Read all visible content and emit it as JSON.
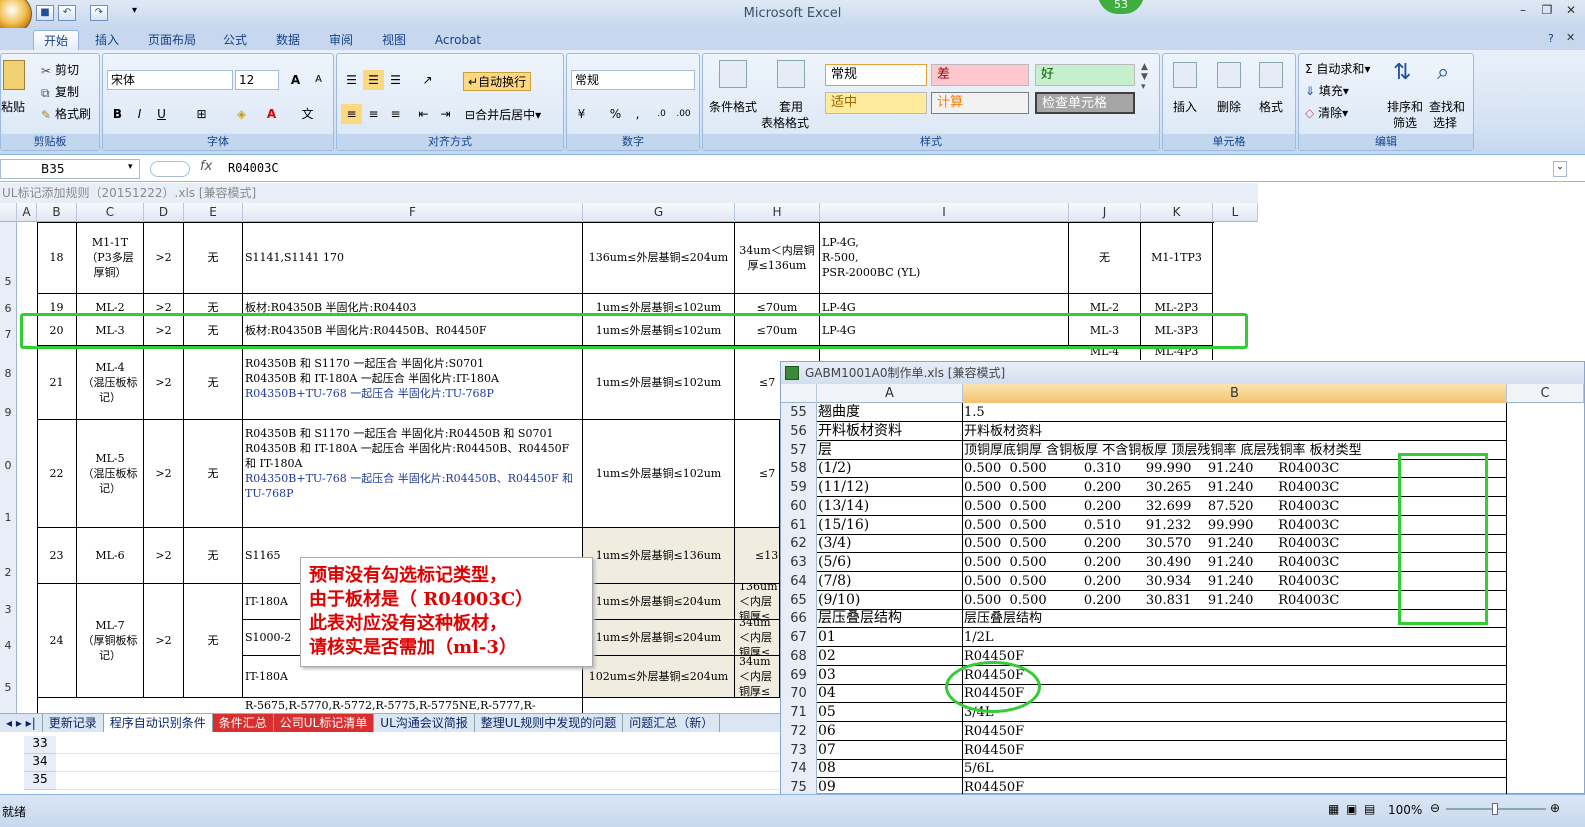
{
  "app": {
    "title": "Microsoft Excel",
    "badge": "53",
    "quick_access": [
      "save",
      "undo",
      "redo"
    ]
  },
  "tabs": [
    "开始",
    "插入",
    "页面布局",
    "公式",
    "数据",
    "审阅",
    "视图",
    "Acrobat"
  ],
  "ribbon": {
    "clipboard": {
      "label": "剪贴板",
      "paste": "粘贴",
      "cut": "剪切",
      "copy": "复制",
      "format_painter": "格式刷"
    },
    "font": {
      "label": "字体",
      "name": "宋体",
      "size": "12",
      "bold": "B",
      "italic": "I",
      "underline": "U",
      "grow": "A",
      "shrink": "A",
      "wen": "文"
    },
    "alignment": {
      "label": "对齐方式",
      "wrap": "自动换行",
      "merge": "合并后居中"
    },
    "number": {
      "label": "数字",
      "format": "常规",
      "percent": "%",
      "comma": ","
    },
    "styles": {
      "label": "样式",
      "cond_format": "条件格式",
      "table_format_1": "套用",
      "table_format_2": "表格格式",
      "normal": "常规",
      "bad": "差",
      "good": "好",
      "neutral": "适中",
      "calc": "计算",
      "check": "检查单元格"
    },
    "cells": {
      "label": "单元格",
      "insert": "插入",
      "delete": "删除",
      "format": "格式"
    },
    "editing": {
      "label": "编辑",
      "autosum": "自动求和",
      "fill": "填充",
      "clear": "清除",
      "sort_1": "排序和",
      "sort_2": "筛选",
      "find_1": "查找和",
      "find_2": "选择"
    }
  },
  "formula_bar": {
    "name_box": "B35",
    "fx": "fx",
    "content": "R04003C"
  },
  "window1": {
    "title": "UL标记添加规则（20151222）.xls  [兼容模式]",
    "columns": [
      "A",
      "B",
      "C",
      "D",
      "E",
      "F",
      "G",
      "H",
      "I",
      "J",
      "K",
      "L"
    ],
    "row_labels": [
      "5",
      "6",
      "7",
      "8",
      "9",
      "0",
      "1",
      "2",
      "3",
      "4",
      "5"
    ],
    "rows": [
      {
        "b": "18",
        "c": "M1-1T\n（P3多层\n厚铜）",
        "d": ">2",
        "e": "无",
        "f": "S1141,S1141 170",
        "g": "136um≤外层基铜≤204um",
        "h": "34um＜内层铜厚≤136um",
        "i": "LP-4G,\nR-500,\nPSR-2000BC (YL)",
        "j": "无",
        "k": "M1-1TP3"
      },
      {
        "b": "19",
        "c": "ML-2",
        "d": ">2",
        "e": "无",
        "f": "板材:R04350B  半固化片:R04403",
        "g": "1um≤外层基铜≤102um",
        "h": "≤70um",
        "i": "LP-4G",
        "j": "ML-2",
        "k": "ML-2P3"
      },
      {
        "b": "20",
        "c": "ML-3",
        "d": ">2",
        "e": "无",
        "f": "板材:R04350B   半固化片:R04450B、R04450F",
        "g": "1um≤外层基铜≤102um",
        "h": "≤70um",
        "i": "LP-4G",
        "j": "ML-3",
        "k": "ML-3P3"
      },
      {
        "b": "21",
        "c": "ML-4\n（混压板标\n记）",
        "d": ">2",
        "e": "无",
        "f1": "R04350B 和 S1170 一起压合 半固化片:S0701",
        "f2": "R04350B 和 IT-180A 一起压合 半固化片:IT-180A",
        "f3": "R04350B+TU-768  一起压合 半固化片:TU-768P",
        "g": "1um≤外层基铜≤102um",
        "h": "≤7",
        "j": "ML-4",
        "k": "ML-4P3"
      },
      {
        "b": "22",
        "c": "ML-5\n（混压板标\n记）",
        "d": ">2",
        "e": "无",
        "f1": "R04350B 和 S1170 一起压合 半固化片:R04450B 和 S0701",
        "f2": "R04350B 和 IT-180A 一起压合 半固化片:R04450B、R04450F 和 IT-180A",
        "f3": "R04350B+TU-768  一起压合 半固化片:R04450B、R04450F 和 TU-768P",
        "g": "1um≤外层基铜≤102um",
        "h": "≤7"
      },
      {
        "b": "23",
        "c": "ML-6",
        "d": ">2",
        "e": "无",
        "f": "S1165",
        "g": "1um≤外层基铜≤136um",
        "h": "≤13"
      },
      {
        "b": "24",
        "c": "ML-7\n（厚铜板标\n记）",
        "d": ">2",
        "e": "无",
        "f1": "IT-180A",
        "f2": "S1000-2",
        "f3": "IT-180A",
        "g1": "1um≤外层基铜≤204um",
        "g2": "1um≤外层基铜≤204um",
        "g3": "102um≤外层基铜≤204um",
        "h1": "136um＜内层铜厚≤",
        "h2": "34um＜内层铜厚≤",
        "h3": "34um＜内层铜厚≤"
      },
      {
        "f": "R-5675,R-5770,R-5772,R-5775,R-5775NE,R-5777,R-"
      }
    ]
  },
  "note": {
    "line1": "预审没有勾选标记类型，",
    "line2": "由于板材是（ R04003C）",
    "line3": "此表对应没有这种板材，",
    "line4": "请核实是否需加（ml-3）"
  },
  "sheet_tabs": [
    "更新记录",
    "程序自动识别条件",
    "条件汇总",
    "公司UL标记清单",
    "UL沟通会议简报",
    "整理UL规则中发现的问题",
    "问题汇总（新）"
  ],
  "sheet_tab_active": "程序自动识别条件",
  "lower_rows": [
    "33",
    "34",
    "35"
  ],
  "window2": {
    "title": "GABM1001A0制作单.xls  [兼容模式]",
    "columns": [
      "A",
      "B",
      "C"
    ],
    "rows": [
      {
        "n": "55",
        "a": "翘曲度",
        "b": "1.5"
      },
      {
        "n": "56",
        "a": "开料板材资料",
        "b": "开料板材资料"
      },
      {
        "n": "57",
        "a": "层",
        "b": "顶铜厚底铜厚 含铜板厚 不含铜板厚 顶层残铜率 底层残铜率 板材类型"
      },
      {
        "n": "58",
        "a": "(1/2)",
        "b": "0.500  0.500         0.310      99.990    91.240      R04003C"
      },
      {
        "n": "59",
        "a": "(11/12)",
        "b": "0.500  0.500         0.200      30.265    91.240      R04003C"
      },
      {
        "n": "60",
        "a": "(13/14)",
        "b": "0.500  0.500         0.200      32.699    87.520      R04003C"
      },
      {
        "n": "61",
        "a": "(15/16)",
        "b": "0.500  0.500         0.510      91.232    99.990      R04003C"
      },
      {
        "n": "62",
        "a": "(3/4)",
        "b": "0.500  0.500         0.200      30.570    91.240      R04003C"
      },
      {
        "n": "63",
        "a": "(5/6)",
        "b": "0.500  0.500         0.200      30.490    91.240      R04003C"
      },
      {
        "n": "64",
        "a": "(7/8)",
        "b": "0.500  0.500         0.200      30.934    91.240      R04003C"
      },
      {
        "n": "65",
        "a": "(9/10)",
        "b": "0.500  0.500         0.200      30.831    91.240      R04003C"
      },
      {
        "n": "66",
        "a": "层压叠层结构",
        "b": "层压叠层结构"
      },
      {
        "n": "67",
        "a": "01",
        "b": "1/2L"
      },
      {
        "n": "68",
        "a": "02",
        "b": "R04450F"
      },
      {
        "n": "69",
        "a": "03",
        "b": "R04450F"
      },
      {
        "n": "70",
        "a": "04",
        "b": "R04450F"
      },
      {
        "n": "71",
        "a": "05",
        "b": "3/4L"
      },
      {
        "n": "72",
        "a": "06",
        "b": "R04450F"
      },
      {
        "n": "73",
        "a": "07",
        "b": "R04450F"
      },
      {
        "n": "74",
        "a": "08",
        "b": "5/6L"
      },
      {
        "n": "75",
        "a": "09",
        "b": "R04450F"
      }
    ]
  },
  "status": {
    "ready": "就绪",
    "zoom": "100%"
  }
}
